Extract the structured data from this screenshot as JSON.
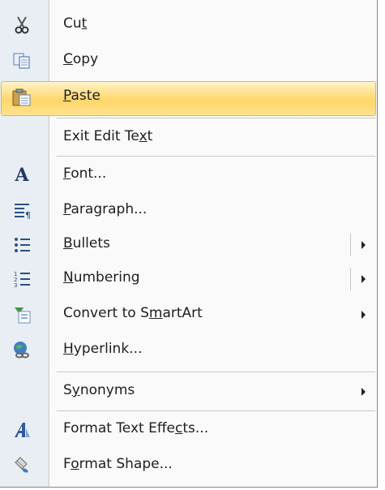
{
  "menu": {
    "items": [
      {
        "key": "cut",
        "pre": "Cu",
        "acc": "t",
        "post": "",
        "icon": "scissors-icon"
      },
      {
        "key": "copy",
        "pre": "",
        "acc": "C",
        "post": "opy",
        "icon": "copy-icon"
      },
      {
        "key": "paste",
        "pre": "",
        "acc": "P",
        "post": "aste",
        "icon": "paste-icon",
        "highlighted": true
      },
      {
        "key": "exit_edit_text",
        "pre": "Exit Edit Te",
        "acc": "x",
        "post": "t"
      },
      {
        "key": "font",
        "pre": "",
        "acc": "F",
        "post": "ont...",
        "icon": "font-icon"
      },
      {
        "key": "paragraph",
        "pre": "",
        "acc": "P",
        "post": "aragraph...",
        "icon": "paragraph-icon"
      },
      {
        "key": "bullets",
        "pre": "",
        "acc": "B",
        "post": "ullets",
        "icon": "bullets-icon",
        "submenu": true
      },
      {
        "key": "numbering",
        "pre": "",
        "acc": "N",
        "post": "umbering",
        "icon": "numbering-icon",
        "submenu": true
      },
      {
        "key": "convert_smartart",
        "pre": "Convert to S",
        "acc": "m",
        "post": "artArt",
        "icon": "smartart-icon",
        "submenu": true
      },
      {
        "key": "hyperlink",
        "pre": "",
        "acc": "H",
        "post": "yperlink...",
        "icon": "hyperlink-icon"
      },
      {
        "key": "synonyms",
        "pre": "S",
        "acc": "y",
        "post": "nonyms",
        "submenu": true
      },
      {
        "key": "format_text_effects",
        "pre": "Format Text Effe",
        "acc": "c",
        "post": "ts...",
        "icon": "text-effects-icon"
      },
      {
        "key": "format_shape",
        "pre": "F",
        "acc": "o",
        "post": "rmat Shape...",
        "icon": "format-shape-icon"
      }
    ]
  },
  "colors": {
    "highlight_border": "#e4b84a",
    "highlight_fill": "#ffd66a",
    "gutter": "#e9eef4"
  }
}
